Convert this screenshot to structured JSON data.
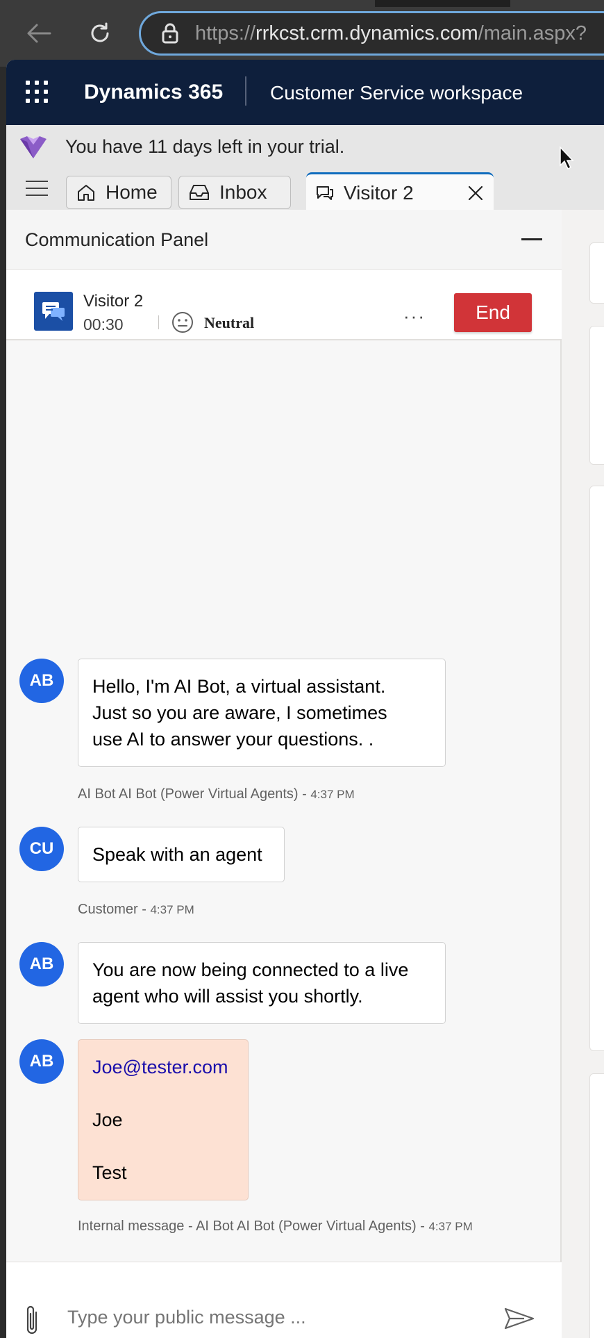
{
  "browser": {
    "url_scheme": "https://",
    "url_host": "rrkcst.crm.dynamics.com",
    "url_path": "/main.aspx?"
  },
  "app": {
    "name": "Dynamics 365",
    "workspace": "Customer Service workspace"
  },
  "trial": {
    "text": "You have 11 days left in your trial."
  },
  "tabs": [
    {
      "label": "Home"
    },
    {
      "label": "Inbox"
    },
    {
      "label": "Visitor 2"
    }
  ],
  "panel": {
    "title": "Communication Panel"
  },
  "session": {
    "name": "Visitor 2",
    "timer": "00:30",
    "sentiment": "Neutral",
    "end_label": "End"
  },
  "messages": [
    {
      "avatar": "AB",
      "lines": [
        "Hello, I'm AI Bot, a virtual assistant.",
        "Just so you are aware, I sometimes",
        "use AI to answer your questions. ."
      ],
      "sender": "AI Bot AI Bot (Power Virtual Agents) - ",
      "time": "4:37 PM"
    },
    {
      "avatar": "CU",
      "lines": [
        "Speak with an agent"
      ],
      "sender": "Customer - ",
      "time": "4:37 PM"
    },
    {
      "avatar": "AB",
      "lines": [
        "You are now being connected to a live",
        "agent who will assist you shortly."
      ]
    },
    {
      "avatar": "AB",
      "email": "Joe@tester.com",
      "first_name": "Joe",
      "last_name": "Test",
      "sender": "Internal message - AI Bot AI Bot (Power Virtual Agents) - ",
      "time": "4:37 PM"
    }
  ],
  "composer": {
    "placeholder": "Type your public message ..."
  },
  "colors": {
    "header_bg": "#0e1f3c",
    "end_button": "#d13438",
    "avatar": "#2266e3",
    "internal_note_bg": "#fde1d3",
    "active_tab_accent": "#0f6cbd"
  }
}
